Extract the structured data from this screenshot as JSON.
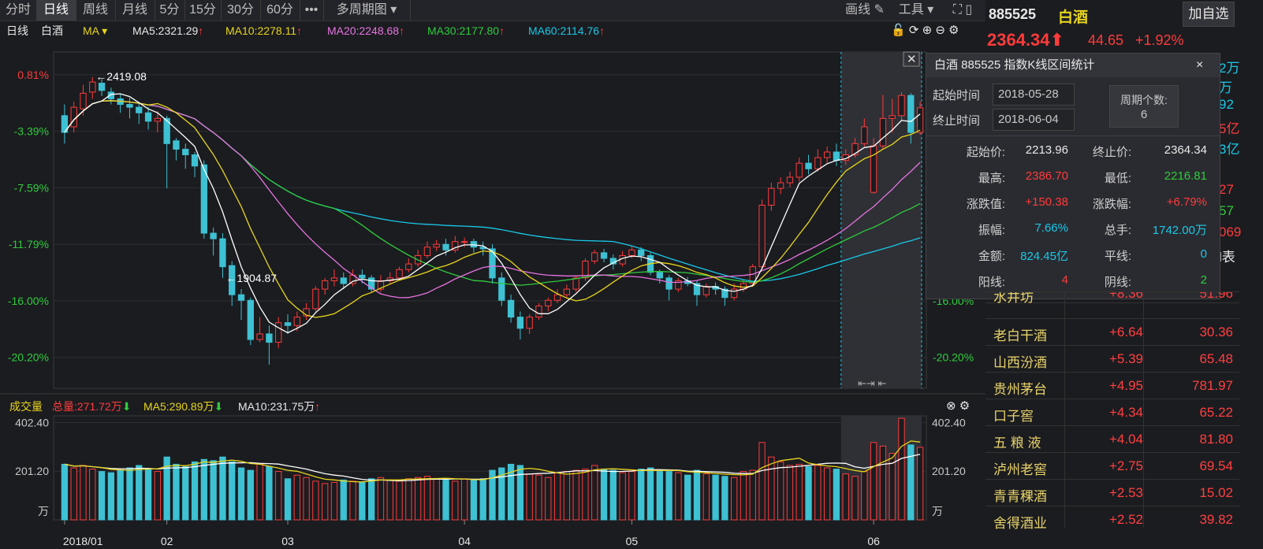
{
  "toolbar": {
    "tabs": [
      "分时",
      "日线",
      "周线",
      "月线",
      "5分",
      "15分",
      "30分",
      "60分",
      "•••",
      "多周期图 ▾"
    ],
    "active_tab": 1,
    "draw_label": "画线",
    "tools_label": "工具 ▾"
  },
  "stock": {
    "code": "885525",
    "name": "白酒",
    "price": "2364.34",
    "change": "44.65",
    "pct": "+1.92%",
    "add_btn": "加自选"
  },
  "ma_legend": {
    "period": "日线",
    "name": "白酒",
    "indicator": "MA ▾",
    "ma5": "MA5:2321.29",
    "ma10": "MA10:2278.11",
    "ma20": "MA20:2248.68",
    "ma30": "MA30:2177.80",
    "ma60": "MA60:2114.76",
    "arrow": "↑"
  },
  "vol_legend": {
    "label": "成交量",
    "total": "总量:271.72万",
    "ma5": "MA5:290.89万",
    "ma10": "MA10:231.75万"
  },
  "colors": {
    "up": "#ff3b3b",
    "down": "#3ec1d3",
    "ma5": "#ffffff",
    "ma10": "#e8d51c",
    "ma20": "#e773e0",
    "ma30": "#2fcc3c",
    "ma60": "#19c8e8"
  },
  "popup": {
    "title": "白酒  885525  指数K线区间统计",
    "close": "×",
    "start_label": "起始时间",
    "start_date": "2018-05-28",
    "end_label": "终止时间",
    "end_date": "2018-06-04",
    "count_label": "周期个数:",
    "count": "6",
    "stats": [
      {
        "l1": "起始价:",
        "v1": "2213.96",
        "c1": "white",
        "l2": "终止价:",
        "v2": "2364.34",
        "c2": "white"
      },
      {
        "l1": "最高:",
        "v1": "2386.70",
        "c1": "red",
        "l2": "最低:",
        "v2": "2216.81",
        "c2": "green"
      },
      {
        "l1": "涨跌值:",
        "v1": "+150.38",
        "c1": "red",
        "l2": "涨跌幅:",
        "v2": "+6.79%",
        "c2": "red"
      },
      {
        "l1": "振幅:",
        "v1": "7.66%",
        "c1": "cyan",
        "l2": "总手:",
        "v2": "1742.00万",
        "c2": "cyan"
      },
      {
        "l1": "金额:",
        "v1": "824.45亿",
        "c1": "cyan",
        "l2": "平线:",
        "v2": "0",
        "c2": "cyan"
      },
      {
        "l1": "阳线:",
        "v1": "4",
        "c1": "red",
        "l2": "阴线:",
        "v2": "2",
        "c2": "green"
      }
    ]
  },
  "side_partial": [
    {
      "text": "2万",
      "color": "cyan"
    },
    {
      "text": "万",
      "color": "cyan"
    },
    {
      "text": "92",
      "color": "cyan"
    },
    {
      "text": "5亿",
      "color": "red"
    },
    {
      "text": "3亿",
      "color": "cyan"
    },
    {
      "text": "27",
      "color": "red"
    },
    {
      "text": "57",
      "color": "green"
    },
    {
      "text": "069",
      "color": "red"
    },
    {
      "text": "l表",
      "color": "white"
    }
  ],
  "list_rows": [
    {
      "name": "水井坊",
      "change": "+8.36",
      "price": "51.96"
    },
    {
      "name": "老白干酒",
      "change": "+6.64",
      "price": "30.36"
    },
    {
      "name": "山西汾酒",
      "change": "+5.39",
      "price": "65.48"
    },
    {
      "name": "贵州茅台",
      "change": "+4.95",
      "price": "781.97"
    },
    {
      "name": "口子窖",
      "change": "+4.34",
      "price": "65.22"
    },
    {
      "name": "五 粮 液",
      "change": "+4.04",
      "price": "81.80"
    },
    {
      "name": "泸州老窖",
      "change": "+2.75",
      "price": "69.54"
    },
    {
      "name": "青青稞酒",
      "change": "+2.53",
      "price": "15.02"
    },
    {
      "name": "舍得酒业",
      "change": "+2.52",
      "price": "39.82"
    }
  ],
  "chart_data": {
    "type": "candlestick",
    "base_price": 2403.6,
    "y_ticks_pct": [
      "0.81%",
      "-3.39%",
      "-7.59%",
      "-11.79%",
      "-16.00%",
      "-20.20%"
    ],
    "y_ticks_pct_values": [
      0.81,
      -3.39,
      -7.59,
      -11.79,
      -16.0,
      -20.2
    ],
    "y_ticks_right": [
      "-16.00%",
      "-20.20%"
    ],
    "ylim_pct": [
      2.5,
      -22.5
    ],
    "x_tick_labels": [
      "2018/01",
      "02",
      "03",
      "04",
      "05",
      "06"
    ],
    "x_tick_index": [
      0,
      11,
      24,
      43,
      61,
      87
    ],
    "annotations": [
      {
        "text": "2419.08",
        "index": 3
      },
      {
        "text": "1904.87",
        "index": 17
      }
    ],
    "vol_ticks": [
      "402.40",
      "201.20",
      "万"
    ],
    "vol_ticks_values": [
      402.4,
      201.2
    ],
    "vol_max": 430,
    "highlight_start": 84,
    "candles": [
      [
        2350,
        2320,
        2370,
        2300,
        230
      ],
      [
        2330,
        2365,
        2375,
        2320,
        215
      ],
      [
        2362,
        2390,
        2405,
        2350,
        225
      ],
      [
        2392,
        2410,
        2419,
        2380,
        210
      ],
      [
        2408,
        2395,
        2415,
        2385,
        200
      ],
      [
        2392,
        2380,
        2400,
        2370,
        195
      ],
      [
        2380,
        2370,
        2388,
        2355,
        205
      ],
      [
        2370,
        2365,
        2382,
        2345,
        215
      ],
      [
        2365,
        2355,
        2375,
        2335,
        225
      ],
      [
        2355,
        2340,
        2365,
        2325,
        210
      ],
      [
        2340,
        2345,
        2358,
        2320,
        200
      ],
      [
        2345,
        2300,
        2350,
        2220,
        260
      ],
      [
        2305,
        2290,
        2310,
        2270,
        230
      ],
      [
        2290,
        2280,
        2300,
        2255,
        220
      ],
      [
        2280,
        2260,
        2285,
        2240,
        240
      ],
      [
        2262,
        2140,
        2270,
        2130,
        250
      ],
      [
        2140,
        2130,
        2150,
        2100,
        245
      ],
      [
        2130,
        2080,
        2140,
        2060,
        260
      ],
      [
        2082,
        2030,
        2090,
        2010,
        240
      ],
      [
        2030,
        2020,
        2040,
        1985,
        215
      ],
      [
        2020,
        1950,
        2025,
        1940,
        205
      ],
      [
        1950,
        1960,
        1990,
        1945,
        230
      ],
      [
        1960,
        1945,
        1975,
        1905,
        220
      ],
      [
        1945,
        1980,
        1990,
        1935,
        200
      ],
      [
        1980,
        1975,
        1995,
        1960,
        170
      ],
      [
        1975,
        1990,
        2000,
        1965,
        185
      ],
      [
        1992,
        2005,
        2015,
        1985,
        175
      ],
      [
        2005,
        2040,
        2045,
        2000,
        160
      ],
      [
        2040,
        2055,
        2060,
        2030,
        150
      ],
      [
        2055,
        2060,
        2075,
        2045,
        155
      ],
      [
        2060,
        2050,
        2070,
        2040,
        165
      ],
      [
        2050,
        2065,
        2075,
        2045,
        160
      ],
      [
        2065,
        2060,
        2075,
        2050,
        155
      ],
      [
        2060,
        2040,
        2065,
        2035,
        170
      ],
      [
        2040,
        2055,
        2065,
        2035,
        175
      ],
      [
        2055,
        2060,
        2070,
        2050,
        165
      ],
      [
        2060,
        2075,
        2080,
        2055,
        160
      ],
      [
        2075,
        2085,
        2095,
        2070,
        170
      ],
      [
        2085,
        2100,
        2110,
        2080,
        175
      ],
      [
        2100,
        2115,
        2125,
        2095,
        180
      ],
      [
        2115,
        2120,
        2128,
        2108,
        170
      ],
      [
        2120,
        2110,
        2130,
        2100,
        165
      ],
      [
        2110,
        2125,
        2135,
        2105,
        160
      ],
      [
        2125,
        2125,
        2132,
        2115,
        170
      ],
      [
        2125,
        2115,
        2130,
        2105,
        165
      ],
      [
        2115,
        2112,
        2125,
        2100,
        170
      ],
      [
        2112,
        2060,
        2120,
        2050,
        205
      ],
      [
        2060,
        2020,
        2070,
        2010,
        215
      ],
      [
        2020,
        1990,
        2030,
        1980,
        230
      ],
      [
        1990,
        1970,
        2000,
        1950,
        225
      ],
      [
        1970,
        1990,
        1995,
        1960,
        190
      ],
      [
        1990,
        2010,
        2015,
        1985,
        185
      ],
      [
        2010,
        2020,
        2025,
        2000,
        175
      ],
      [
        2020,
        2030,
        2040,
        2015,
        195
      ],
      [
        2030,
        2040,
        2048,
        2025,
        200
      ],
      [
        2040,
        2060,
        2065,
        2035,
        205
      ],
      [
        2060,
        2090,
        2095,
        2055,
        210
      ],
      [
        2090,
        2105,
        2110,
        2085,
        225
      ],
      [
        2105,
        2095,
        2112,
        2088,
        210
      ],
      [
        2095,
        2085,
        2102,
        2075,
        205
      ],
      [
        2085,
        2100,
        2108,
        2080,
        195
      ],
      [
        2100,
        2110,
        2118,
        2095,
        200
      ],
      [
        2110,
        2100,
        2115,
        2090,
        210
      ],
      [
        2100,
        2070,
        2105,
        2065,
        215
      ],
      [
        2070,
        2060,
        2075,
        2050,
        200
      ],
      [
        2060,
        2040,
        2065,
        2020,
        200
      ],
      [
        2040,
        2055,
        2060,
        2035,
        195
      ],
      [
        2055,
        2050,
        2062,
        2045,
        185
      ],
      [
        2050,
        2030,
        2055,
        2010,
        205
      ],
      [
        2030,
        2045,
        2050,
        2025,
        190
      ],
      [
        2045,
        2040,
        2052,
        2030,
        185
      ],
      [
        2040,
        2025,
        2045,
        2010,
        180
      ],
      [
        2025,
        2040,
        2050,
        2020,
        175
      ],
      [
        2040,
        2050,
        2058,
        2035,
        200
      ],
      [
        2050,
        2080,
        2085,
        2045,
        205
      ],
      [
        2080,
        2190,
        2200,
        2075,
        320
      ],
      [
        2190,
        2220,
        2230,
        2180,
        260
      ],
      [
        2220,
        2230,
        2240,
        2210,
        240
      ],
      [
        2230,
        2240,
        2250,
        2222,
        225
      ],
      [
        2240,
        2265,
        2275,
        2232,
        230
      ],
      [
        2265,
        2255,
        2280,
        2245,
        220
      ],
      [
        2255,
        2275,
        2290,
        2250,
        225
      ],
      [
        2275,
        2285,
        2295,
        2265,
        215
      ],
      [
        2285,
        2270,
        2300,
        2260,
        210
      ],
      [
        2270,
        2280,
        2290,
        2262,
        190
      ],
      [
        2280,
        2300,
        2310,
        2275,
        180
      ],
      [
        2300,
        2330,
        2345,
        2295,
        200
      ],
      [
        2213,
        2296,
        2310,
        2210,
        320
      ],
      [
        2296,
        2345,
        2387,
        2290,
        305
      ],
      [
        2345,
        2350,
        2380,
        2320,
        275
      ],
      [
        2350,
        2386,
        2392,
        2340,
        420
      ],
      [
        2386,
        2320,
        2390,
        2300,
        310
      ],
      [
        2320,
        2364,
        2375,
        2316,
        300
      ]
    ]
  }
}
